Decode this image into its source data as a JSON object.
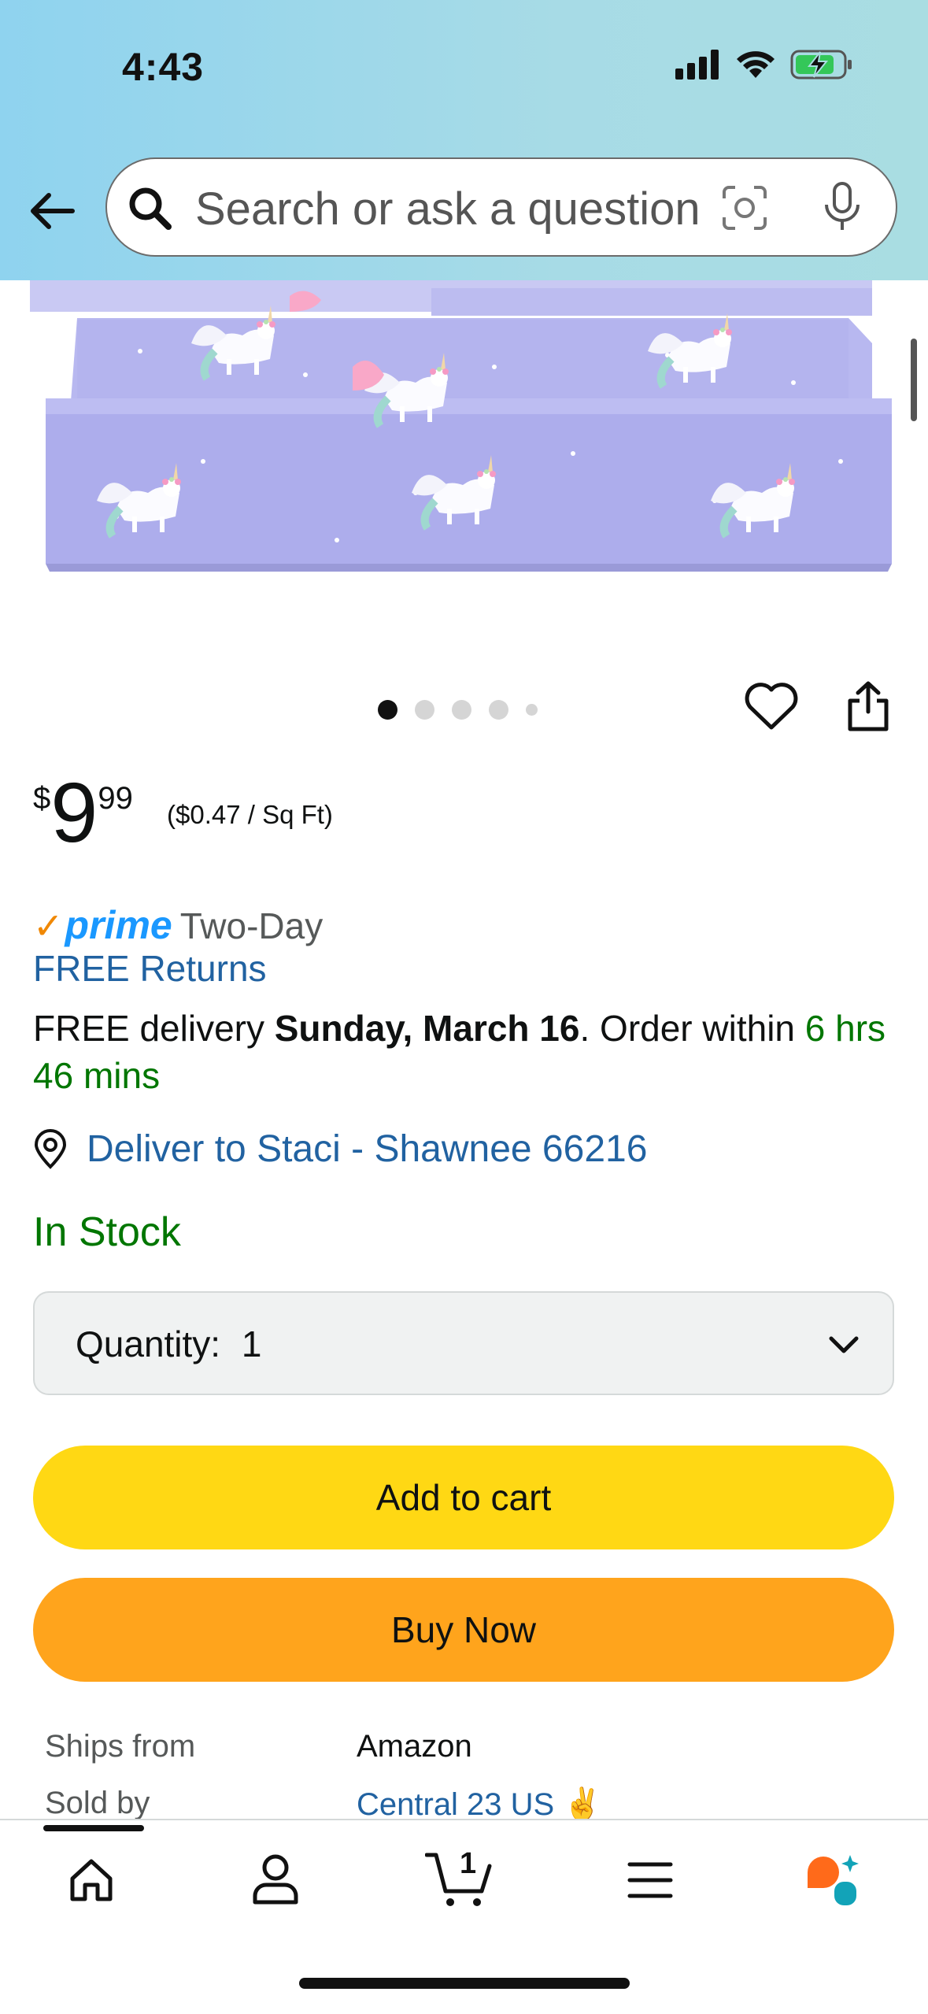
{
  "status_bar": {
    "time": "4:43"
  },
  "search": {
    "placeholder": "Search or ask a question"
  },
  "product": {
    "price_currency": "$",
    "price_whole": "9",
    "price_fraction": "99",
    "unit_price": "($0.47 / Sq Ft)",
    "image_count": 5,
    "active_image": 1
  },
  "delivery": {
    "prime_word": "prime",
    "prime_speed": "Two-Day",
    "free_returns": "FREE Returns",
    "prefix": "FREE delivery ",
    "date": "Sunday, March 16",
    "order_within_prefix": ". Order within ",
    "countdown": "6 hrs 46 mins",
    "deliver_to": "Deliver to Staci - Shawnee 66216"
  },
  "stock_status": "In Stock",
  "quantity": {
    "label": "Quantity:",
    "value": "1"
  },
  "buttons": {
    "add_to_cart": "Add to cart",
    "buy_now": "Buy Now"
  },
  "seller_info": {
    "ships_from_label": "Ships from",
    "ships_from_value": "Amazon",
    "sold_by_label": "Sold by",
    "sold_by_value": "Central 23 US ✌️"
  },
  "bottom_nav": {
    "cart_count": "1",
    "items": [
      "home-icon",
      "account-icon",
      "cart-icon",
      "menu-icon",
      "rufus-icon"
    ]
  },
  "colors": {
    "add_to_cart": "#ffd814",
    "buy_now": "#ffa41c",
    "link": "#2162a1",
    "in_stock": "#007600",
    "prime_blue": "#1a98ff"
  }
}
